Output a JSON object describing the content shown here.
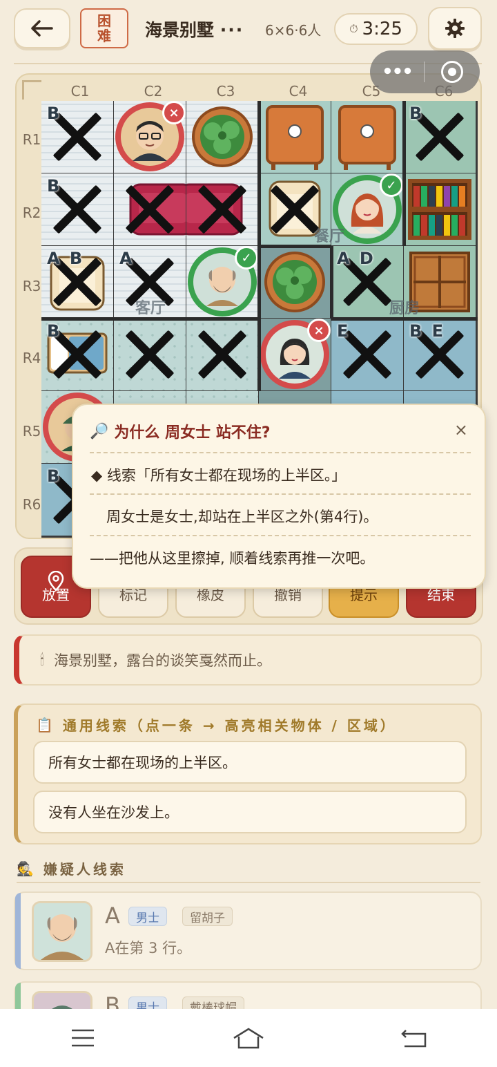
{
  "header": {
    "back_icon": "arrow-left-icon",
    "difficulty": [
      "困",
      "难"
    ],
    "title": "海景别墅",
    "more": "···",
    "size": "6×6·6人",
    "timer": "3:25",
    "settings_icon": "gear-icon"
  },
  "board": {
    "columns": [
      "C1",
      "C2",
      "C3",
      "C4",
      "C5",
      "C6"
    ],
    "rows": [
      "R1",
      "R2",
      "R3",
      "R4",
      "R5",
      "R6"
    ],
    "room_labels": {
      "dining": "餐厅",
      "living": "客厅",
      "kitchen": "厨房"
    },
    "tags": {
      "r1c1": "B",
      "r1c6": "B",
      "r2c1": "B",
      "r3c1": "A B",
      "r3c2": "A",
      "r3c5": "A D",
      "r4c1": "B",
      "r4c5": "E",
      "r4c6": "B E",
      "r6c1": "B"
    },
    "badges": {
      "wrong": "×",
      "right": "✓"
    }
  },
  "tools": {
    "place": "放置",
    "mark": "标记",
    "eraser": "橡皮",
    "undo": "撤销",
    "hint": "提示",
    "end": "结束"
  },
  "popup": {
    "title": "为什么 周女士 站不住?",
    "close": "×",
    "line1": "◆ 线索「所有女士都在现场的上半区。」",
    "line2": "周女士是女士,却站在上半区之外(第4行)。",
    "line3": "——把他从这里擦掉, 顺着线索再推一次吧。"
  },
  "story": {
    "icon": "candle-icon",
    "text": "海景别墅，露台的谈笑戛然而止。"
  },
  "general_clues": {
    "heading": "通用线索（点一条 → 高亮相关物体 / 区域）",
    "items": [
      "所有女士都在现场的上半区。",
      "没有人坐在沙发上。"
    ]
  },
  "suspects": {
    "heading": "嫌疑人线索",
    "list": [
      {
        "letter": "A",
        "gender": "男士",
        "trait": "留胡子",
        "desc": "A在第 3 行。",
        "color": "#9fb5d8"
      },
      {
        "letter": "B",
        "gender": "男士",
        "trait": "戴棒球帽",
        "desc": "",
        "color": "#8fc79a"
      }
    ]
  },
  "colors": {
    "accent": "#b5352f",
    "hint": "#e6b04a",
    "ok": "#3aa24e",
    "bad": "#d44b4b"
  }
}
